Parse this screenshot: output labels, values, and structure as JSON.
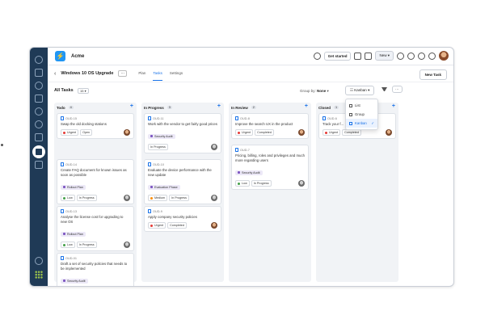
{
  "app": {
    "name": "Acme",
    "logo_glyph": "⚡"
  },
  "topbar": {
    "get_started": "Get started",
    "new_label": "New",
    "colors": {
      "brand": "#2196f3",
      "rail": "#1f3a56"
    }
  },
  "project": {
    "title": "Windows 10 OS Upgrade",
    "more": "···",
    "tabs": [
      "Plan",
      "Tasks",
      "Settings"
    ],
    "active_tab": "Tasks",
    "new_task": "New Task"
  },
  "filter": {
    "all_tasks": "All Tasks",
    "count": "15",
    "group_by_label": "Group by:",
    "group_by_value": "None",
    "view": "Kanban",
    "more": "···"
  },
  "view_menu": {
    "items": [
      {
        "label": "List"
      },
      {
        "label": "Group"
      },
      {
        "label": "Kanban",
        "selected": true
      }
    ]
  },
  "columns": [
    {
      "name": "Todo",
      "count": "4",
      "cards": [
        {
          "id": "OUD-15",
          "title": "Swap the old docking stations",
          "chips": [
            "Urgent",
            "Open"
          ],
          "chip_colors": [
            "#e53935",
            ""
          ],
          "avatar": "a"
        },
        {
          "id": "OUD-14",
          "title": "Create FAQ document for known issues as soon as possible",
          "label": "Rollout Plan",
          "chips": [
            "Low",
            "In Progress"
          ],
          "chip_colors": [
            "#43a047",
            ""
          ],
          "avatar": "b"
        },
        {
          "id": "OUD-13",
          "title": "Analyse the license cost for upgrading to new OS",
          "label": "Rollout Plan",
          "chips": [
            "Low",
            "In Progress"
          ],
          "chip_colors": [
            "#43a047",
            ""
          ],
          "avatar": "b"
        },
        {
          "id": "OUD-01",
          "title": "Draft a set of security policies that needs to be implemented",
          "label": "Security Audit",
          "chips": [
            "Low",
            "In Progress"
          ],
          "chip_colors": [
            "#43a047",
            ""
          ],
          "avatar": "b"
        }
      ]
    },
    {
      "name": "In Progress",
      "count": "3",
      "cards": [
        {
          "id": "OUD-11",
          "title": "Work with the vendor to get fairly good prices",
          "label": "Security Audit",
          "chips": [
            "In Progress"
          ],
          "chip_colors": [
            ""
          ],
          "avatar": "b"
        },
        {
          "id": "OUD-10",
          "title": "Evaluate the device performance with the new update",
          "label": "Evaluation Phase",
          "chips": [
            "Medium",
            "In Progress"
          ],
          "chip_colors": [
            "#fb8c00",
            ""
          ],
          "avatar": "b"
        },
        {
          "id": "OUD-9",
          "title": "Apply company security policies",
          "chips": [
            "Urgent",
            "Completed"
          ],
          "chip_colors": [
            "#e53935",
            ""
          ],
          "avatar": "a"
        }
      ]
    },
    {
      "name": "In Review",
      "count": "2",
      "cards": [
        {
          "id": "OUD-8",
          "title": "Improve the search UX in the product",
          "chips": [
            "Urgent",
            "Completed"
          ],
          "chip_colors": [
            "#e53935",
            ""
          ],
          "avatar": "a"
        },
        {
          "id": "OUD-7",
          "title": "Pricing, billing, roles and privileges and much more regarding users",
          "label": "Security Audit",
          "chips": [
            "Low",
            "In Progress"
          ],
          "chip_colors": [
            "#43a047",
            ""
          ],
          "avatar": "b"
        }
      ]
    },
    {
      "name": "Closed",
      "count": "1",
      "cards": [
        {
          "id": "OUD-6",
          "title": "Track your f...",
          "chips": [
            "Urgent",
            "Completed"
          ],
          "chip_colors": [
            "#e53935",
            ""
          ],
          "avatar": "a"
        }
      ]
    }
  ]
}
